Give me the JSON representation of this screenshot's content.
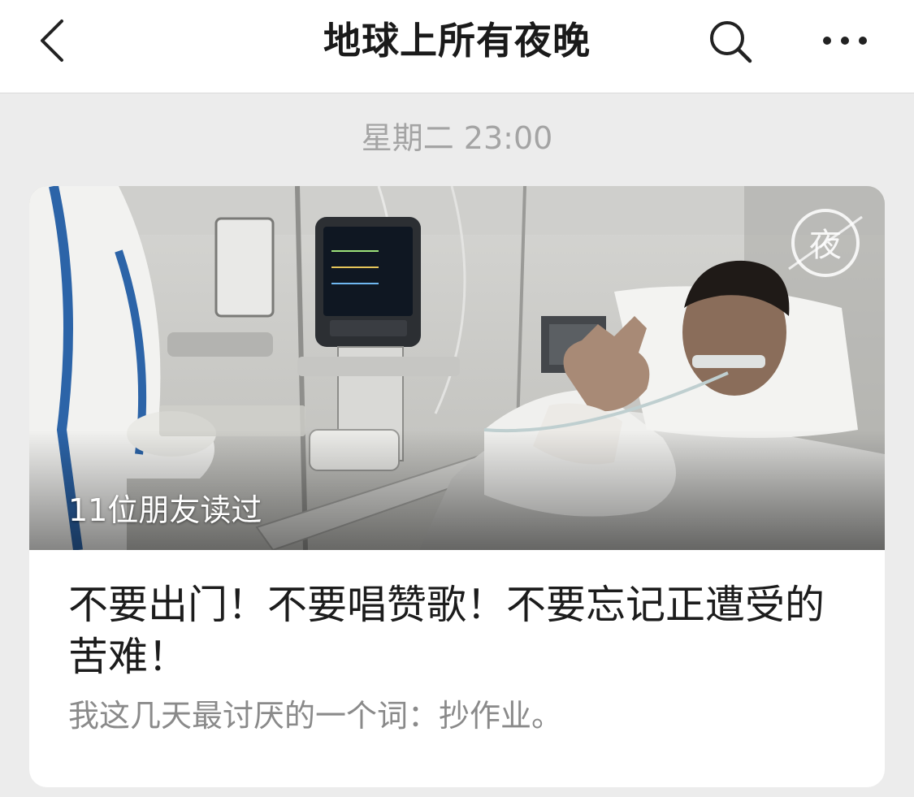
{
  "header": {
    "title": "地球上所有夜晚",
    "back_icon": "chevron-left-icon",
    "search_icon": "search-icon",
    "more_icon": "more-horizontal-icon"
  },
  "feed": {
    "timestamp": "星期二 23:00",
    "article": {
      "read_count": "11位朋友读过",
      "title": "不要出门！不要唱赞歌！不要忘记正遭受的苦难！",
      "digest": "我这几天最讨厌的一个词：抄作业。",
      "cover_watermark": "夜"
    }
  },
  "colors": {
    "background": "#ececec",
    "header_bg": "#ffffff",
    "timestamp": "#a4a4a4",
    "title_text": "#1c1c1c",
    "digest_text": "#8a8a8a"
  }
}
